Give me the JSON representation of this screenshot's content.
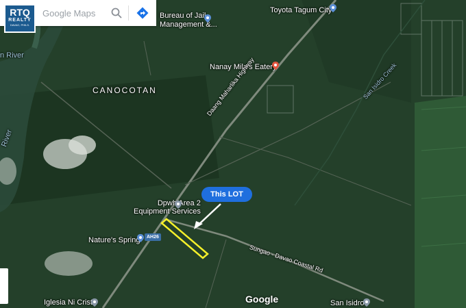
{
  "search": {
    "text": "Google Maps"
  },
  "logo": {
    "line1": "RTQ",
    "line2": "REALTY",
    "line3": "DAVAO, PHILS."
  },
  "callout": {
    "text": "This LOT"
  },
  "places": {
    "bureau": "Bureau of Jail\nManagement &...",
    "toyota": "Toyota Tagum City",
    "nanay": "Nanay Mila's Eatery",
    "canocotan": "CANOCOTAN",
    "dpwh": "Dpwh Area 2\nEquipment Services",
    "natures": "Nature's Spring",
    "iglesia": "Iglesia Ni Cristo",
    "sanisidro": "San Isidro",
    "river1": "n River",
    "river2": "River"
  },
  "roads": {
    "highway": "Daang Maharlika Highway",
    "coastal": "Sungao - Davao Coastal Rd",
    "creek": "San Isidro Creek",
    "shield": "AH26"
  },
  "branding": {
    "google": "Google"
  },
  "colors": {
    "lot_outline": "#f5f02a",
    "callout_bg": "#1f6fde",
    "place_pin_red": "#e2553f",
    "place_pin_blue": "#5b8fd6"
  },
  "icons": {
    "search": "search-icon",
    "directions": "directions-icon"
  }
}
